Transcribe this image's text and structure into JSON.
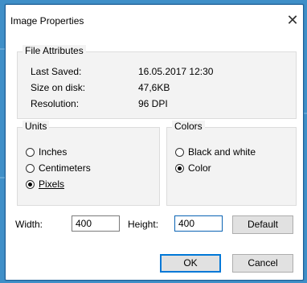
{
  "dialog": {
    "title": "Image Properties",
    "close_symbol": "✕"
  },
  "file_attributes": {
    "legend": "File Attributes",
    "rows": [
      {
        "label": "Last Saved:",
        "value": "16.05.2017 12:30"
      },
      {
        "label": "Size on disk:",
        "value": "47,6KB"
      },
      {
        "label": "Resolution:",
        "value": "96 DPI"
      }
    ]
  },
  "units": {
    "legend": "Units",
    "options": [
      {
        "label": "Inches",
        "selected": false
      },
      {
        "label": "Centimeters",
        "selected": false
      },
      {
        "label": "Pixels",
        "selected": true
      }
    ]
  },
  "colors": {
    "legend": "Colors",
    "options": [
      {
        "label": "Black and white",
        "selected": false
      },
      {
        "label": "Color",
        "selected": true
      }
    ]
  },
  "size": {
    "width_label": "Width:",
    "width_value": "400",
    "height_label": "Height:",
    "height_value": "400",
    "default_button": "Default"
  },
  "buttons": {
    "ok": "OK",
    "cancel": "Cancel"
  },
  "icons": {
    "close": "close-icon",
    "radio": "radio-button"
  },
  "colors_theme": {
    "background": "#3f8fc8",
    "group_bg": "#f3f3f3",
    "accent": "#0078d7"
  }
}
